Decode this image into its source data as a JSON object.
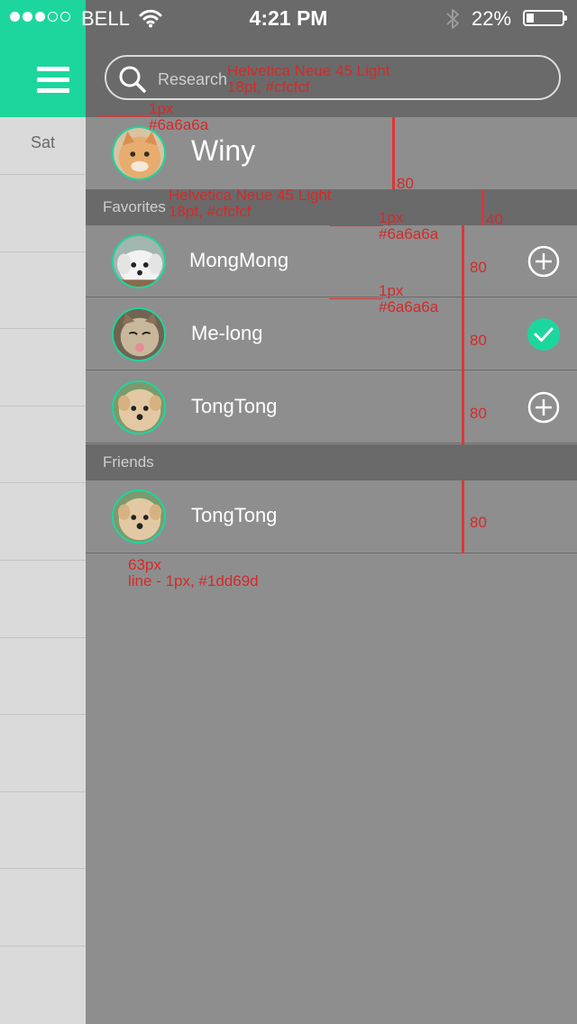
{
  "status_bar": {
    "carrier": "BELL",
    "time": "4:21 PM",
    "battery": "22%",
    "battery_level": 0.22,
    "signal_bars": 3,
    "signal_total": 5
  },
  "menu_icon": "hamburger-icon",
  "sidebar": {
    "day_label": "Sat"
  },
  "search": {
    "placeholder": "Research",
    "icon": "search-icon"
  },
  "me": {
    "name": "Winy"
  },
  "favorites": {
    "title": "Favorites",
    "items": [
      {
        "name": "MongMong",
        "action": "add-icon"
      },
      {
        "name": "Me-long",
        "action": "check-icon"
      },
      {
        "name": "TongTong",
        "action": "add-icon"
      }
    ]
  },
  "friends": {
    "title": "Friends",
    "items": [
      {
        "name": "TongTong"
      }
    ]
  },
  "annotations": {
    "search_font": "Helvetica Neue 45 Light",
    "search_size": "18pt, #cfcfcf",
    "divider_1": "1px",
    "divider_1_color": "#6a6a6a",
    "me_height": "80",
    "section_font": "Helvetica Neue 45 Light",
    "section_size": "18pt, #cfcfcf",
    "section_divider": "1px",
    "section_divider_color": "#6a6a6a",
    "section_height": "40",
    "row_divider": "1px",
    "row_divider_color": "#6a6a6a",
    "row_height_1": "80",
    "row_height_2": "80",
    "row_height_3": "80",
    "row_height_4": "80",
    "avatar_size": "63px",
    "avatar_line": "line - 1px, #1dd69d"
  },
  "colors": {
    "accent": "#1dd69d",
    "header": "#6a6a6a",
    "body": "#8e8e8e",
    "sidebar": "#dadada",
    "annotation": "#d42a2a"
  }
}
